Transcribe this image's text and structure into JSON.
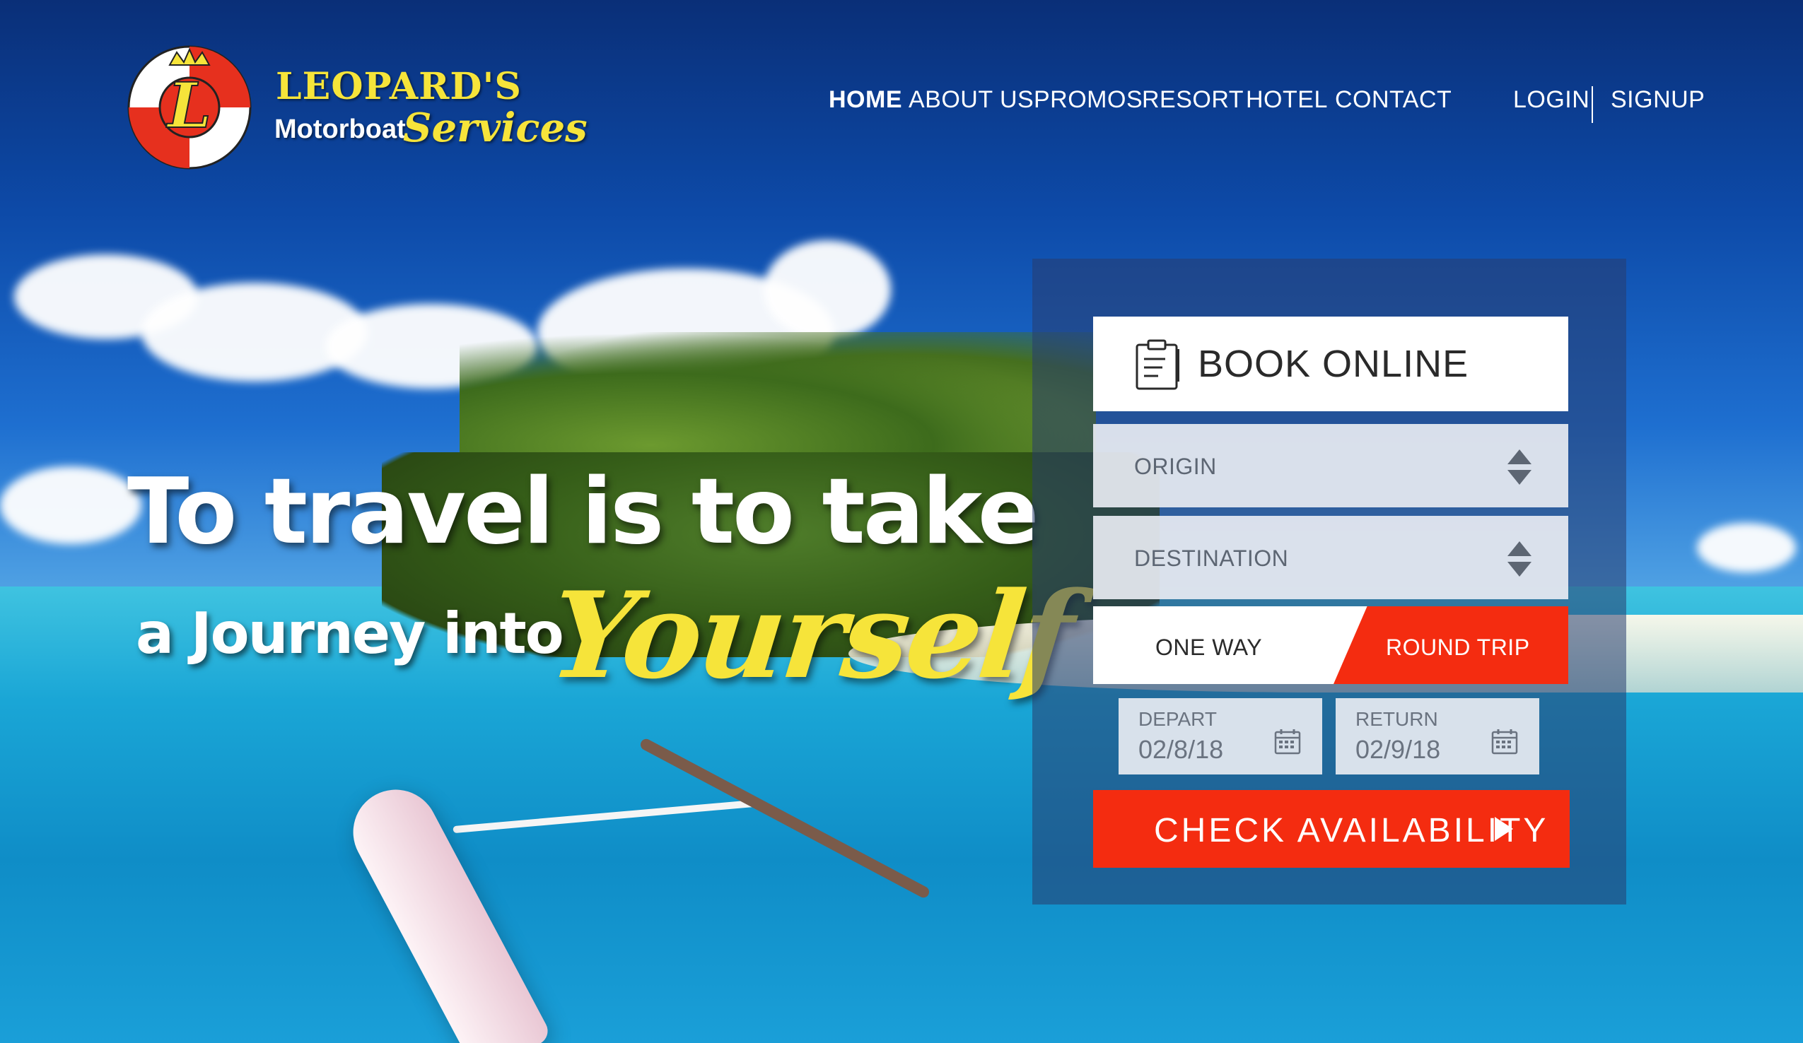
{
  "brand": {
    "name_line1": "LEOPARD'S",
    "name_line2a": "Motorboat",
    "name_line2b": "Services",
    "logo_letter": "L",
    "colors": {
      "yellow": "#f6e43a",
      "red": "#e6301e"
    }
  },
  "nav": {
    "items": [
      {
        "label": "HOME",
        "active": true
      },
      {
        "label": "ABOUT US"
      },
      {
        "label": "PROMOS"
      },
      {
        "label": "RESORT"
      },
      {
        "label": "HOTEL"
      },
      {
        "label": "CONTACT"
      }
    ],
    "login": "LOGIN",
    "signup": "SIGNUP"
  },
  "hero": {
    "line1": "To travel is to take",
    "line2": "a Journey into",
    "emphasis": "Yourself"
  },
  "booking": {
    "title": "BOOK ONLINE",
    "title_icon": "clipboard-icon",
    "origin": {
      "placeholder": "ORIGIN",
      "icon": "updown-arrows-icon"
    },
    "destination": {
      "placeholder": "DESTINATION",
      "icon": "updown-arrows-icon"
    },
    "trip": {
      "one_way": "ONE WAY",
      "round_trip": "ROUND TRIP",
      "selected": "ROUND TRIP"
    },
    "depart": {
      "label": "DEPART",
      "value": "02/8/18",
      "icon": "calendar-icon"
    },
    "return": {
      "label": "RETURN",
      "value": "02/9/18",
      "icon": "calendar-icon"
    },
    "check_button": "CHECK AVAILABILITY",
    "check_icon": "play-arrow-icon",
    "accent_color": "#f42c10"
  }
}
